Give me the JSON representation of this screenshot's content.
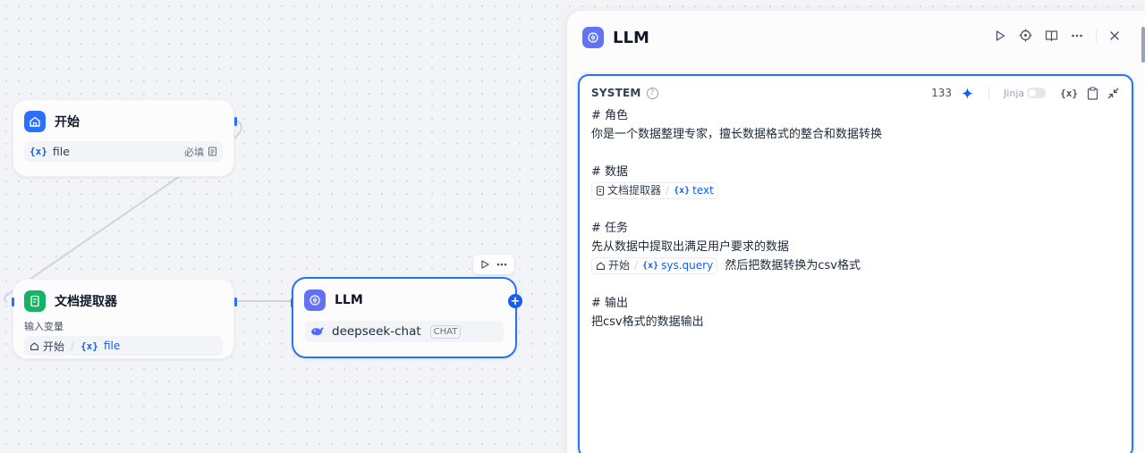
{
  "nodes": {
    "start": {
      "title": "开始",
      "var_glyph": "{x}",
      "field": "file",
      "required": "必填"
    },
    "extractor": {
      "title": "文档提取器",
      "input_label": "输入变量",
      "src_node": "开始",
      "var_glyph": "{x}",
      "src_var": "file"
    },
    "llm": {
      "title": "LLM",
      "model": "deepseek-chat",
      "mode_badge": "CHAT"
    }
  },
  "panel": {
    "title": "LLM",
    "prompt": {
      "role_label": "SYSTEM",
      "help": "?",
      "char_count": "133",
      "jinja_label": "Jinja",
      "var_btn": "{x}",
      "lines": {
        "l1": "# 角色",
        "l2": "你是一个数据整理专家，擅长数据格式的整合和数据转换",
        "l4": "# 数据",
        "l5_node": "文档提取器",
        "l5_glyph": "{x}",
        "l5_var": "text",
        "l7": "# 任务",
        "l8": "先从数据中提取出满足用户要求的数据",
        "l9_node": "开始",
        "l9_glyph": "{x}",
        "l9_var": "sys.query",
        "l9_tail": "然后把数据转换为csv格式",
        "l11": "# 输出",
        "l12": "把csv格式的数据输出"
      }
    }
  },
  "colors": {
    "accent": "#155eef",
    "start_icon_bg": "#2970ff",
    "extractor_icon_bg": "#16b364",
    "llm_icon_bg": "#6172f3"
  },
  "icons": {
    "start": "home-icon",
    "extractor": "document-icon",
    "llm": "brain-icon",
    "model": "whale-icon"
  }
}
